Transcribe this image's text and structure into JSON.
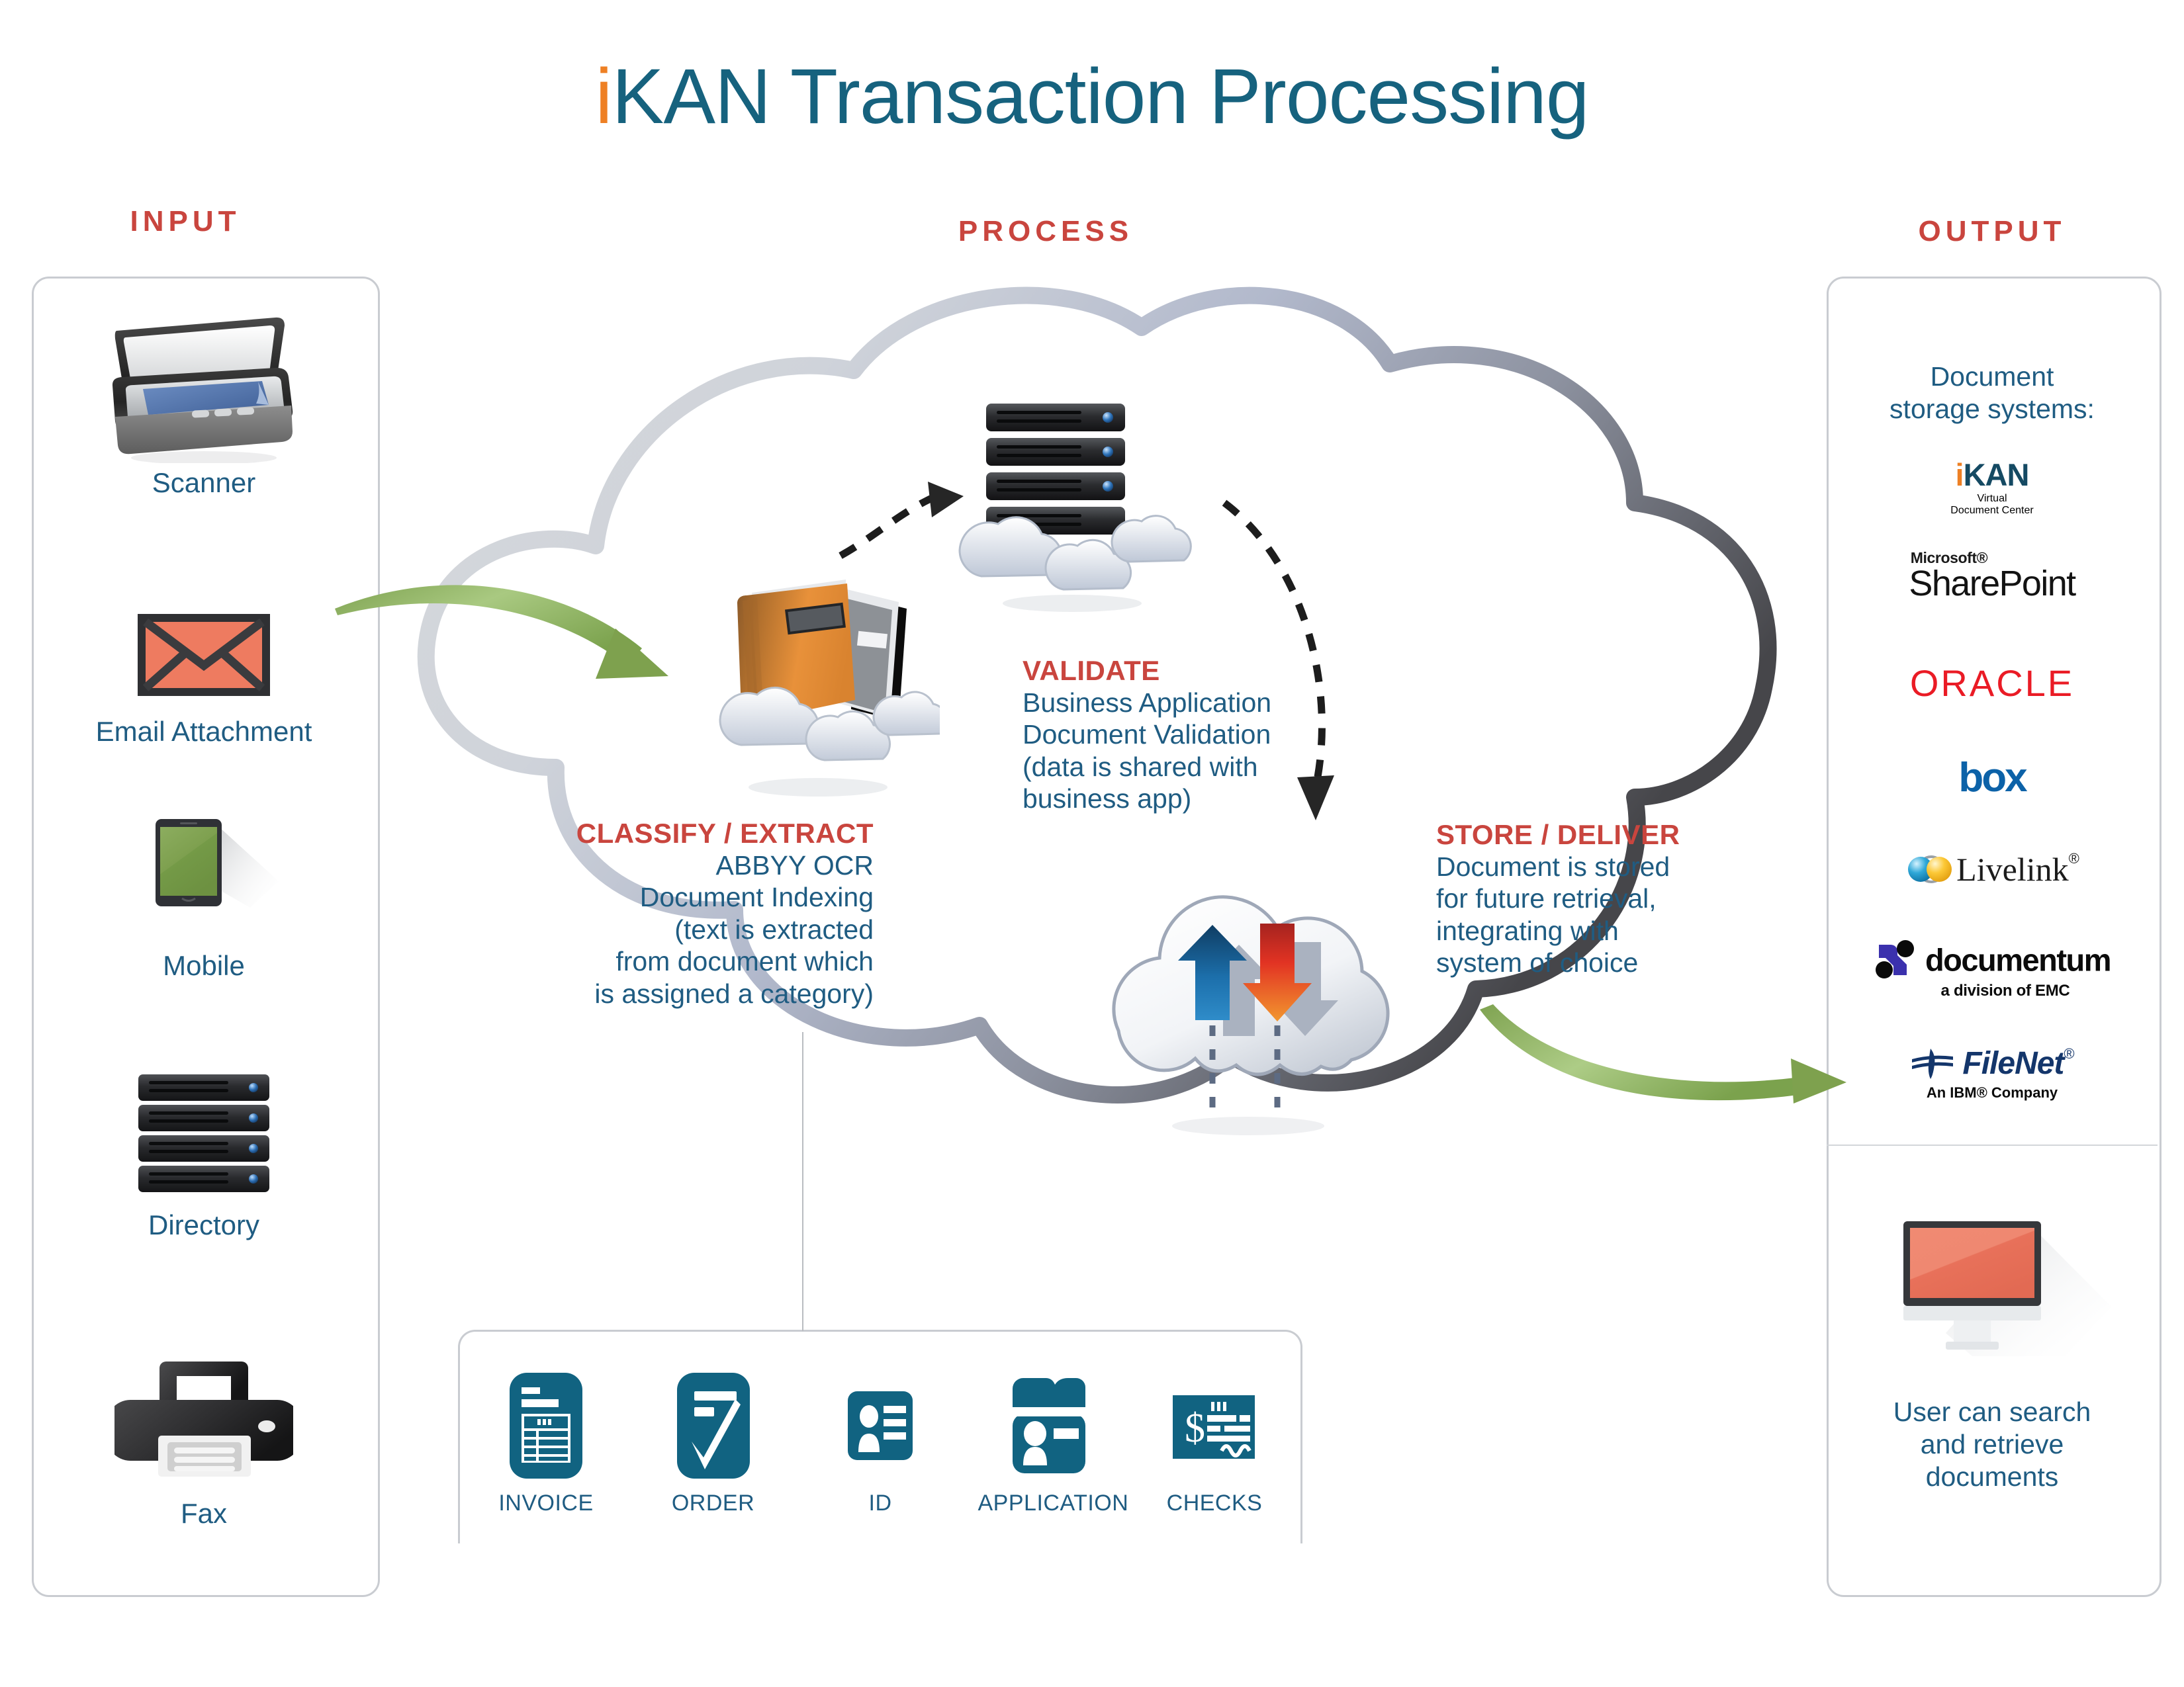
{
  "title": {
    "accent": "i",
    "rest": "KAN Transaction Processing"
  },
  "columns": {
    "input_label": "INPUT",
    "process_label": "PROCESS",
    "output_label": "OUTPUT"
  },
  "input": {
    "items": [
      {
        "icon": "scanner-icon",
        "label": "Scanner"
      },
      {
        "icon": "envelope-icon",
        "label": "Email Attachment"
      },
      {
        "icon": "mobile-icon",
        "label": "Mobile"
      },
      {
        "icon": "server-rack-icon",
        "label": "Directory"
      },
      {
        "icon": "printer-fax-icon",
        "label": "Fax"
      }
    ]
  },
  "process": {
    "classify": {
      "title": "CLASSIFY / EXTRACT",
      "lines": [
        "ABBYY OCR",
        "Document Indexing",
        "(text is extracted",
        "from document which",
        "is assigned a category)"
      ]
    },
    "validate": {
      "title": "VALIDATE",
      "lines": [
        "Business Application",
        "Document Validation",
        "(data is shared with",
        "business app)"
      ]
    },
    "store": {
      "title": "STORE / DELIVER",
      "lines": [
        "Document is stored",
        "for future retrieval,",
        "integrating with",
        "system of choice"
      ]
    }
  },
  "document_types": {
    "items": [
      {
        "icon": "invoice-icon",
        "label": "INVOICE"
      },
      {
        "icon": "order-check-icon",
        "label": "ORDER"
      },
      {
        "icon": "id-card-icon",
        "label": "ID"
      },
      {
        "icon": "application-folder-icon",
        "label": "APPLICATION"
      },
      {
        "icon": "bank-check-icon",
        "label": "CHECKS"
      }
    ]
  },
  "output": {
    "storage_heading_line1": "Document",
    "storage_heading_line2": "storage systems:",
    "logos": [
      {
        "name": "ikan-virtual-document-center-logo",
        "text": "iKAN",
        "sub1": "Virtual",
        "sub2": "Document Center"
      },
      {
        "name": "microsoft-sharepoint-logo",
        "small": "Microsoft®",
        "text": "SharePoint"
      },
      {
        "name": "oracle-logo",
        "text": "ORACLE"
      },
      {
        "name": "box-logo",
        "text": "box"
      },
      {
        "name": "livelink-logo",
        "text": "Livelink"
      },
      {
        "name": "documentum-logo",
        "text": "documentum",
        "sub": "a division of EMC"
      },
      {
        "name": "filenet-logo",
        "text": "FileNet",
        "sub": "An IBM® Company"
      }
    ],
    "monitor_caption": [
      "User can search",
      "and retrieve",
      "documents"
    ]
  },
  "colors": {
    "title_teal": "#16627e",
    "title_orange": "#ee8024",
    "header_red": "#c9453e",
    "body_blue": "#1f5c82",
    "arrow_green": "#7fa94f",
    "panel_border": "#c9ccd1"
  }
}
